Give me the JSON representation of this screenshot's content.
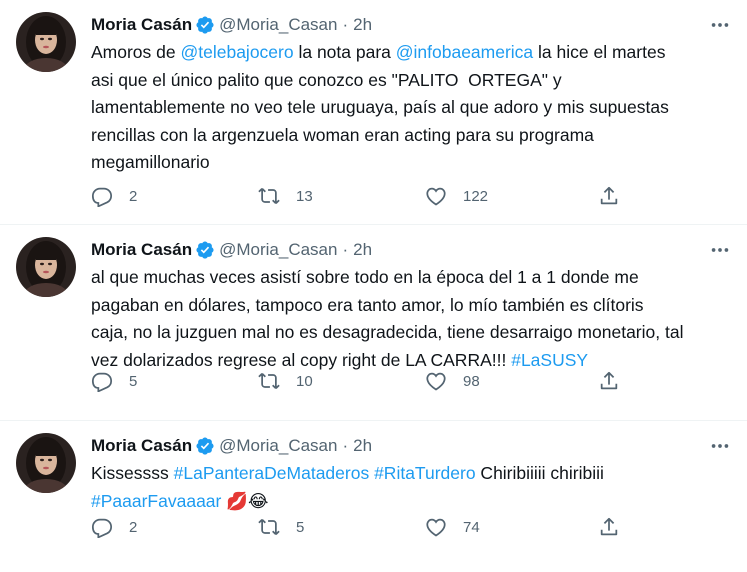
{
  "colors": {
    "link": "#1d9bf0",
    "secondary": "#536471",
    "verified": "#1d9bf0"
  },
  "icons": {
    "more": "ellipsis-icon",
    "reply": "reply-icon",
    "retweet": "retweet-icon",
    "like": "heart-icon",
    "share": "share-icon",
    "verified": "verified-badge-icon"
  },
  "tweets": [
    {
      "name": "Moria Casán",
      "handle": "@Moria_Casan",
      "dot": "·",
      "time": "2h",
      "segments": [
        {
          "text": "Amoros de ",
          "link": false
        },
        {
          "text": "@telebajocero",
          "link": true
        },
        {
          "text": " la nota para ",
          "link": false
        },
        {
          "text": "@infobaeamerica",
          "link": true
        },
        {
          "text": " la hice el martes\nasi que el único palito que conozco es \"PALITO  ORTEGA\" y\nlamentablemente no veo tele uruguaya, país al que adoro y mis supuestas\nrencillas con la argenzuela woman eran acting para su programa\nmegamillonario",
          "link": false
        }
      ],
      "replies": "2",
      "retweets": "13",
      "likes": "122"
    },
    {
      "name": "Moria Casán",
      "handle": "@Moria_Casan",
      "dot": "·",
      "time": "2h",
      "segments": [
        {
          "text": "al que muchas veces asistí sobre todo en la época del 1 a 1 donde me\npagaban en dólares, tampoco era tanto amor, lo mío también es clítoris\ncaja, no la juzguen mal no es desagradecida, tiene desarraigo monetario, tal\nvez dolarizados regrese al copy right de LA CARRA!!! ",
          "link": false
        },
        {
          "text": "#LaSUSY",
          "link": true
        }
      ],
      "replies": "5",
      "retweets": "10",
      "likes": "98"
    },
    {
      "name": "Moria Casán",
      "handle": "@Moria_Casan",
      "dot": "·",
      "time": "2h",
      "segments": [
        {
          "text": "Kissessss ",
          "link": false
        },
        {
          "text": "#LaPanteraDeMataderos",
          "link": true
        },
        {
          "text": " ",
          "link": false
        },
        {
          "text": "#RitaTurdero",
          "link": true
        },
        {
          "text": " Chiribiiiii chiribiii\n",
          "link": false
        },
        {
          "text": "#PaaarFavaaaar",
          "link": true
        },
        {
          "text": " 💋😂",
          "link": false
        }
      ],
      "replies": "2",
      "retweets": "5",
      "likes": "74"
    }
  ]
}
